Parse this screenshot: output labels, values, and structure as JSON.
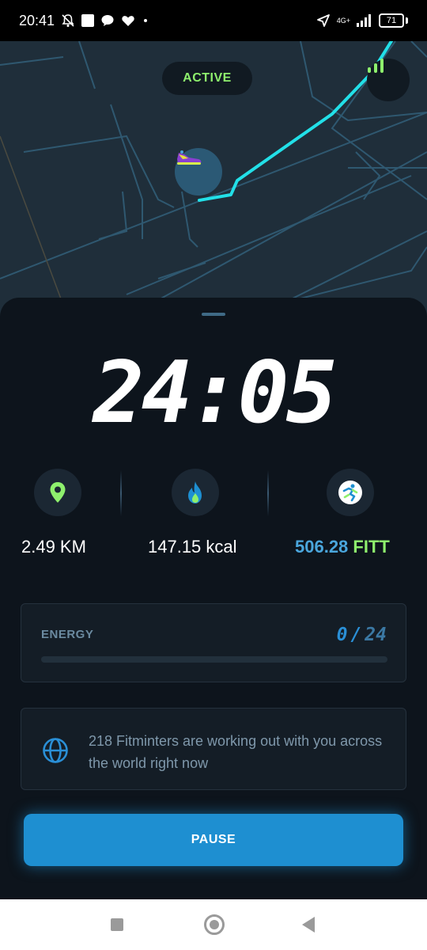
{
  "status_bar": {
    "time": "20:41",
    "network": "4G+",
    "battery": "71"
  },
  "map": {
    "status_label": "ACTIVE",
    "route_color": "#22e0e8"
  },
  "workout": {
    "timer": "24:05",
    "distance": "2.49 KM",
    "calories": "147.15 kcal",
    "fitt_value": "506.28",
    "fitt_unit": "FITT"
  },
  "energy": {
    "label": "ENERGY",
    "current": "0",
    "separator": "/",
    "max": "24",
    "fraction": 0
  },
  "community": {
    "message": "218 Fitminters are working out with you across the world right now"
  },
  "actions": {
    "pause_label": "PAUSE"
  },
  "colors": {
    "accent_green": "#8ef06d",
    "accent_blue": "#1e8fd1",
    "sheet_bg": "#0d141c",
    "map_bg": "#1f2e3a"
  }
}
